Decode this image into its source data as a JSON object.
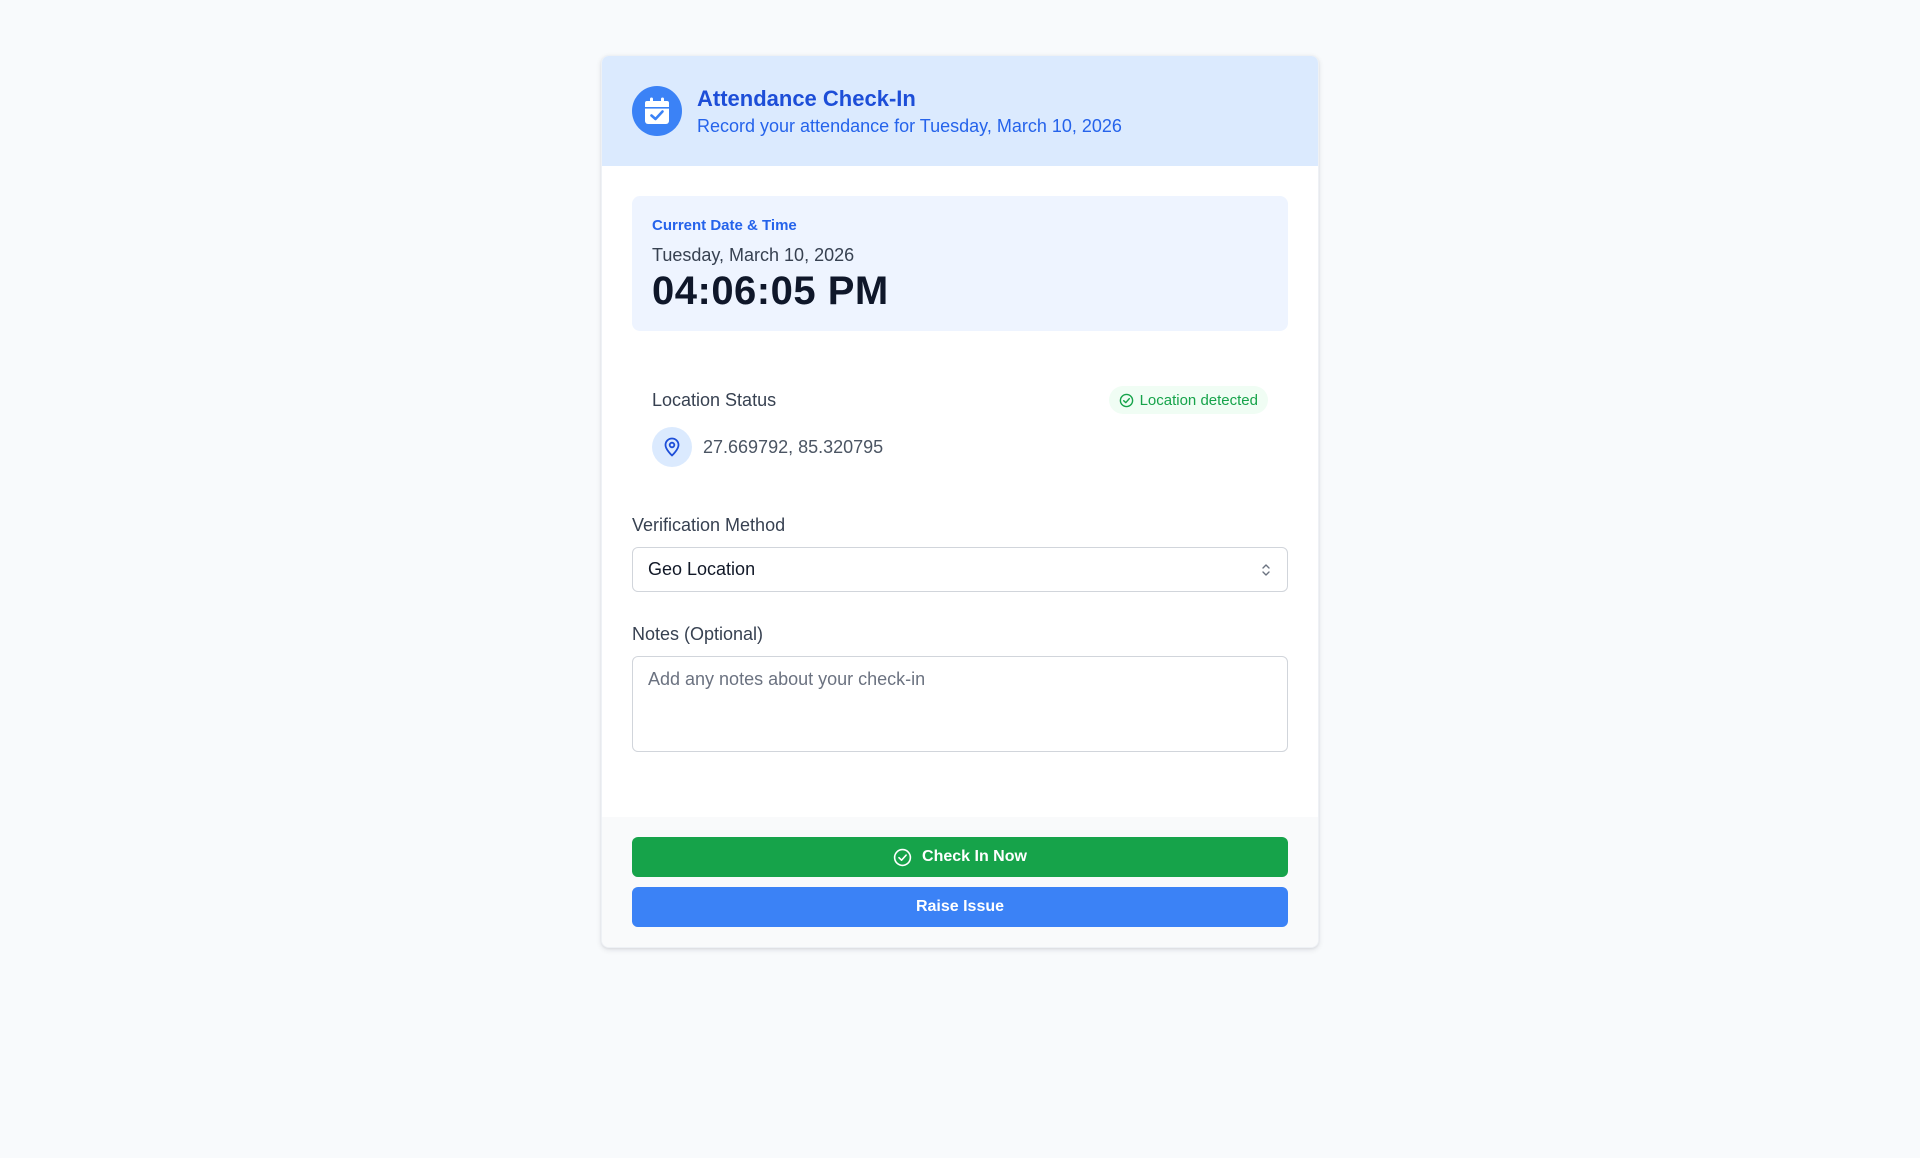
{
  "header": {
    "title": "Attendance Check-In",
    "subtitle": "Record your attendance for Tuesday, March 10, 2026",
    "icon": "calendar-check-icon"
  },
  "datetime": {
    "label": "Current Date & Time",
    "date": "Tuesday, March 10, 2026",
    "time": "04:06:05 PM"
  },
  "location": {
    "title": "Location Status",
    "badge": "Location detected",
    "coordinates": "27.669792, 85.320795",
    "icon": "map-pin-icon"
  },
  "verification": {
    "label": "Verification Method",
    "selected": "Geo Location"
  },
  "notes": {
    "label": "Notes (Optional)",
    "placeholder": "Add any notes about your check-in",
    "value": ""
  },
  "actions": {
    "check_in": "Check In Now",
    "raise_issue": "Raise Issue"
  },
  "colors": {
    "primary": "#3b82f6",
    "success": "#16a34a",
    "header_bg": "#dbeafe"
  }
}
